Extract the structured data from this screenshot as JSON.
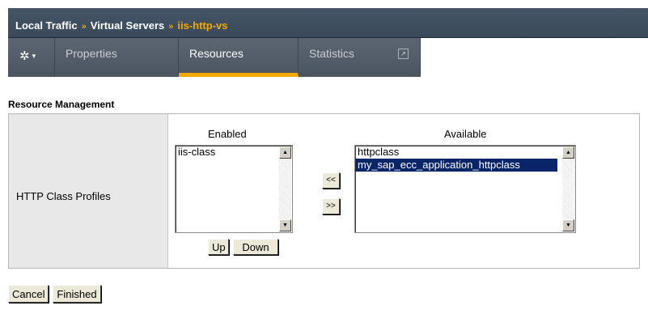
{
  "breadcrumb": {
    "part1": "Local Traffic",
    "sep1": "»",
    "part2": "Virtual Servers",
    "sep2": "»",
    "current": "iis-http-vs"
  },
  "tabs": {
    "gear_icon": "gear-icon",
    "items": [
      {
        "label": "Properties"
      },
      {
        "label": "Resources"
      },
      {
        "label": "Statistics"
      }
    ],
    "active": "Resources"
  },
  "section": {
    "title": "Resource Management"
  },
  "profiles": {
    "label": "HTTP Class Profiles",
    "enabled_header": "Enabled",
    "available_header": "Available",
    "enabled_items": [
      "iis-class"
    ],
    "available_items": [
      "httpclass",
      "my_sap_ecc_application_httpclass"
    ],
    "available_selected": "my_sap_ecc_application_httpclass",
    "move_left_label": "<<",
    "move_right_label": ">>",
    "up_label": "Up",
    "down_label": "Down"
  },
  "footer": {
    "cancel_label": "Cancel",
    "finished_label": "Finished"
  },
  "colors": {
    "header_bg": "#3f4f60",
    "accent": "#f5a800",
    "selection": "#0a246a"
  }
}
